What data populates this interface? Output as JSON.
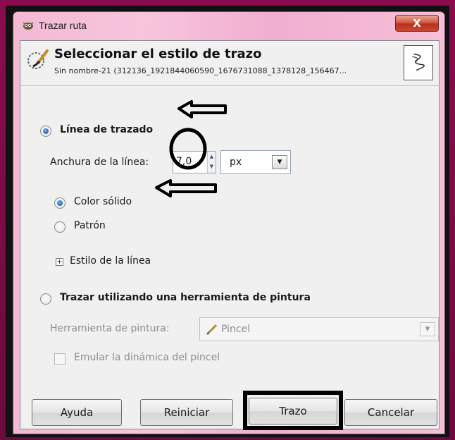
{
  "window": {
    "title": "Trazar ruta",
    "close_label": "X"
  },
  "header": {
    "title": "Seleccionar el estilo de trazo",
    "subtitle": "Sin nombre-21 (312136_1921844060590_1676731088_1378128_156467..."
  },
  "stroke_line": {
    "label": "Línea de trazado",
    "selected": true,
    "width_label": "Anchura de la línea:",
    "width_value": "7,0",
    "unit_value": "px",
    "fill_options": [
      {
        "label": "Color sólido",
        "selected": true
      },
      {
        "label": "Patrón",
        "selected": false
      }
    ],
    "line_style_label": "Estilo de la línea"
  },
  "paint_tool": {
    "label": "Trazar utilizando una herramienta de pintura",
    "selected": false,
    "tool_label": "Herramienta de pintura:",
    "tool_value": "Pincel",
    "emulate_label": "Emular la dinámica del pincel",
    "emulate_checked": false
  },
  "buttons": {
    "help": "Ayuda",
    "reset": "Reiniciar",
    "stroke": "Trazo",
    "cancel": "Cancelar"
  },
  "colors": {
    "window_frame": "#f4b9d4",
    "client_bg": "#f0f0f0",
    "radio_selected": "#1a5fb4",
    "close_button": "#c74a33",
    "annotation": "#000000"
  },
  "icons": {
    "title": "gimp-wilber-icon",
    "header": "paintbrush-stroke-icon",
    "preview": "path-preview-icon",
    "tool": "paintbrush-icon"
  }
}
